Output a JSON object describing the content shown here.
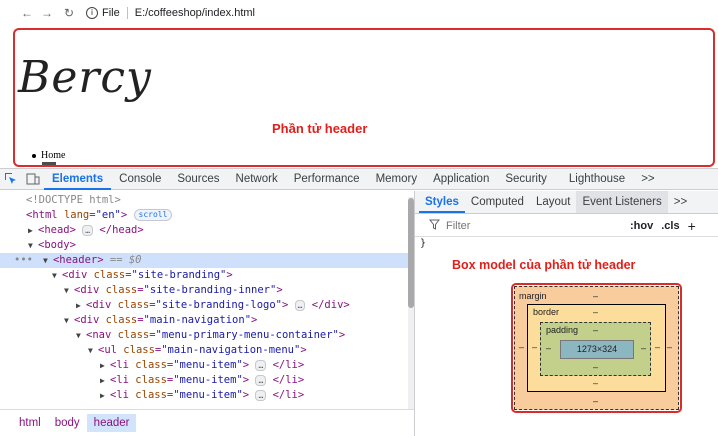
{
  "browser": {
    "back_icon": "arrow-left-icon",
    "forward_icon": "arrow-right-icon",
    "reload_icon": "reload-icon",
    "site_info": "File",
    "url": "E:/coffeeshop/index.html"
  },
  "page": {
    "logo": "Bercy",
    "header_annotation": "Phần tử header",
    "menu_item": "Home"
  },
  "devtools": {
    "tabs": [
      "Elements",
      "Console",
      "Sources",
      "Network",
      "Performance",
      "Memory",
      "Application",
      "Security",
      "Lighthouse",
      ">>"
    ],
    "active_tab": "Elements",
    "dom": {
      "doctype": "<!DOCTYPE html>",
      "html_open": "<html",
      "html_attr_name": "lang",
      "html_attr_value": "\"en\"",
      "html_close_bracket": ">",
      "scroll_badge": "scroll",
      "head": "<head>",
      "head_close": "</head>",
      "body": "<body>",
      "header": "<header>",
      "selected_marker": "== $0",
      "ellipsis": "…",
      "rows": [
        {
          "tag": "div",
          "cls": "\"site-branding\"",
          "suffix": ">",
          "indent": 4
        },
        {
          "tag": "div",
          "cls": "\"site-branding-inner\"",
          "suffix": ">",
          "indent": 5
        },
        {
          "tag": "div",
          "cls": "\"site-branding-logo\"",
          "suffix": "> … </div>",
          "indent": 6
        },
        {
          "tag": "div",
          "cls": "\"main-navigation\"",
          "suffix": ">",
          "indent": 5
        },
        {
          "tag": "nav",
          "cls": "\"menu-primary-menu-container\"",
          "suffix": ">",
          "indent": 6
        },
        {
          "tag": "ul",
          "cls": "\"main-navigation-menu\"",
          "suffix": ">",
          "indent": 7
        },
        {
          "tag": "li",
          "cls": "\"menu-item\"",
          "suffix": "> … </li>",
          "indent": 8
        },
        {
          "tag": "li",
          "cls": "\"menu-item\"",
          "suffix": "> … </li>",
          "indent": 8
        },
        {
          "tag": "li",
          "cls": "\"menu-item\"",
          "suffix": "> … </li>",
          "indent": 8
        }
      ],
      "breadcrumbs": [
        "html",
        "body",
        "header"
      ]
    },
    "styles_tabs": [
      "Styles",
      "Computed",
      "Layout",
      "Event Listeners",
      ">>"
    ],
    "filter_placeholder": "Filter",
    "hov": ":hov",
    "cls": ".cls",
    "plus": "+",
    "close_brace": "}",
    "box_model_annotation": "Box model của phần tử header",
    "box_model": {
      "margin_label": "margin",
      "border_label": "border",
      "padding_label": "padding",
      "content_size": "1273×324",
      "dash": "–"
    }
  }
}
